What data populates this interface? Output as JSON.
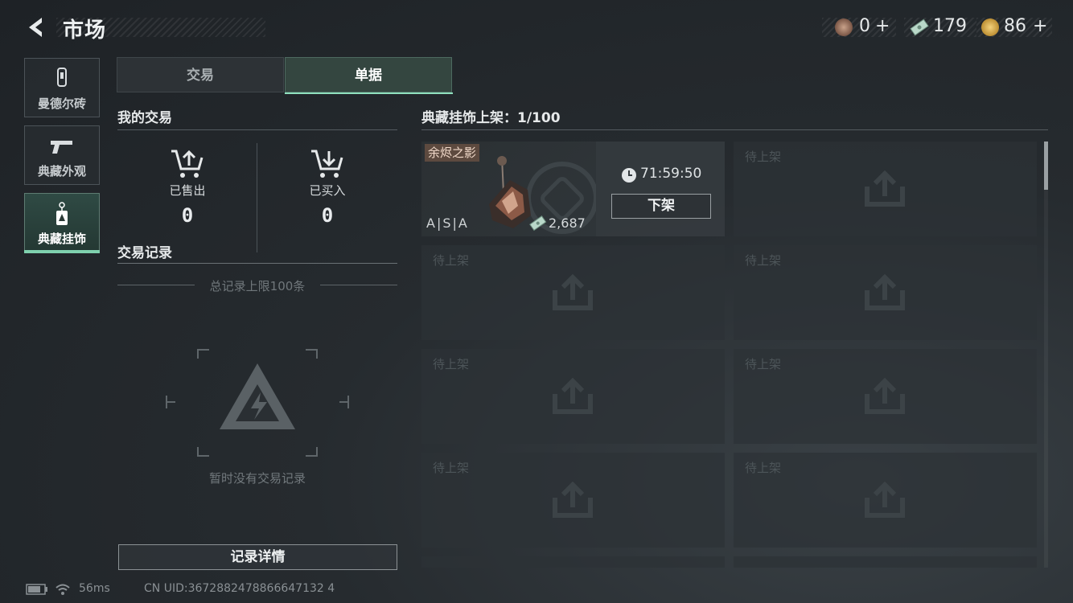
{
  "header": {
    "title": "市场",
    "currencies": [
      {
        "icon": "badge-coin-icon",
        "value": "0",
        "plus": "+"
      },
      {
        "icon": "banknote-icon",
        "value": "179",
        "plus": ""
      },
      {
        "icon": "gold-coin-icon",
        "value": "86",
        "plus": "+"
      }
    ]
  },
  "sidebar": {
    "items": [
      {
        "label": "曼德尔砖",
        "icon": "brick-icon"
      },
      {
        "label": "典藏外观",
        "icon": "pistol-icon"
      },
      {
        "label": "典藏挂饰",
        "icon": "charm-tag-icon",
        "active": true
      }
    ]
  },
  "tabs": [
    {
      "label": "交易",
      "active": false
    },
    {
      "label": "单据",
      "active": true
    }
  ],
  "my_trades": {
    "title": "我的交易",
    "sold": {
      "label": "已售出",
      "value": "0"
    },
    "bought": {
      "label": "已买入",
      "value": "0"
    }
  },
  "trade_records": {
    "title": "交易记录",
    "limit_text": "总记录上限100条",
    "empty_text": "暂时没有交易记录",
    "detail_button": "记录详情"
  },
  "listings": {
    "title": "典藏挂饰上架：1/100",
    "item": {
      "name": "余烬之影",
      "code": "A|S|A",
      "price": "2,687",
      "timer": "71:59:50",
      "delist_label": "下架"
    },
    "empty_slot_label": "待上架"
  },
  "status_bar": {
    "ping": "56ms",
    "uid": "CN UID:3672882478866647132 4"
  },
  "colors": {
    "accent": "#7fd1ae",
    "active_tab": "#344640"
  }
}
